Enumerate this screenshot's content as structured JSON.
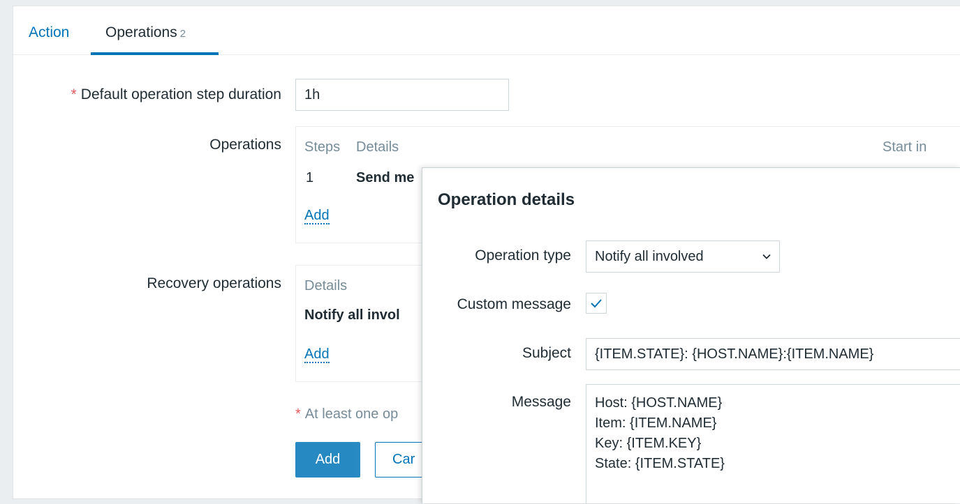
{
  "tabs": {
    "action": "Action",
    "operations": "Operations",
    "operations_count": "2"
  },
  "form": {
    "step_duration_label": "Default operation step duration",
    "step_duration_value": "1h",
    "operations_label": "Operations",
    "operations_table": {
      "col_steps": "Steps",
      "col_details": "Details",
      "col_start_in": "Start in",
      "row_step": "1",
      "row_details": "Send me",
      "add": "Add"
    },
    "recovery_label": "Recovery operations",
    "recovery_table": {
      "col_details": "Details",
      "row_details": "Notify all invol",
      "add": "Add"
    },
    "hint": "At least one op",
    "add_button": "Add",
    "cancel_button": "Car"
  },
  "modal": {
    "title": "Operation details",
    "operation_type_label": "Operation type",
    "operation_type_value": "Notify all involved",
    "custom_message_label": "Custom message",
    "custom_message_checked": true,
    "subject_label": "Subject",
    "subject_value": "{ITEM.STATE}: {HOST.NAME}:{ITEM.NAME}",
    "message_label": "Message",
    "message_value": "Host: {HOST.NAME}\nItem: {ITEM.NAME}\nKey: {ITEM.KEY}\nState: {ITEM.STATE}"
  },
  "colors": {
    "link": "#0275b8",
    "required": "#e45959",
    "muted": "#768d99",
    "text": "#1f2c33"
  }
}
